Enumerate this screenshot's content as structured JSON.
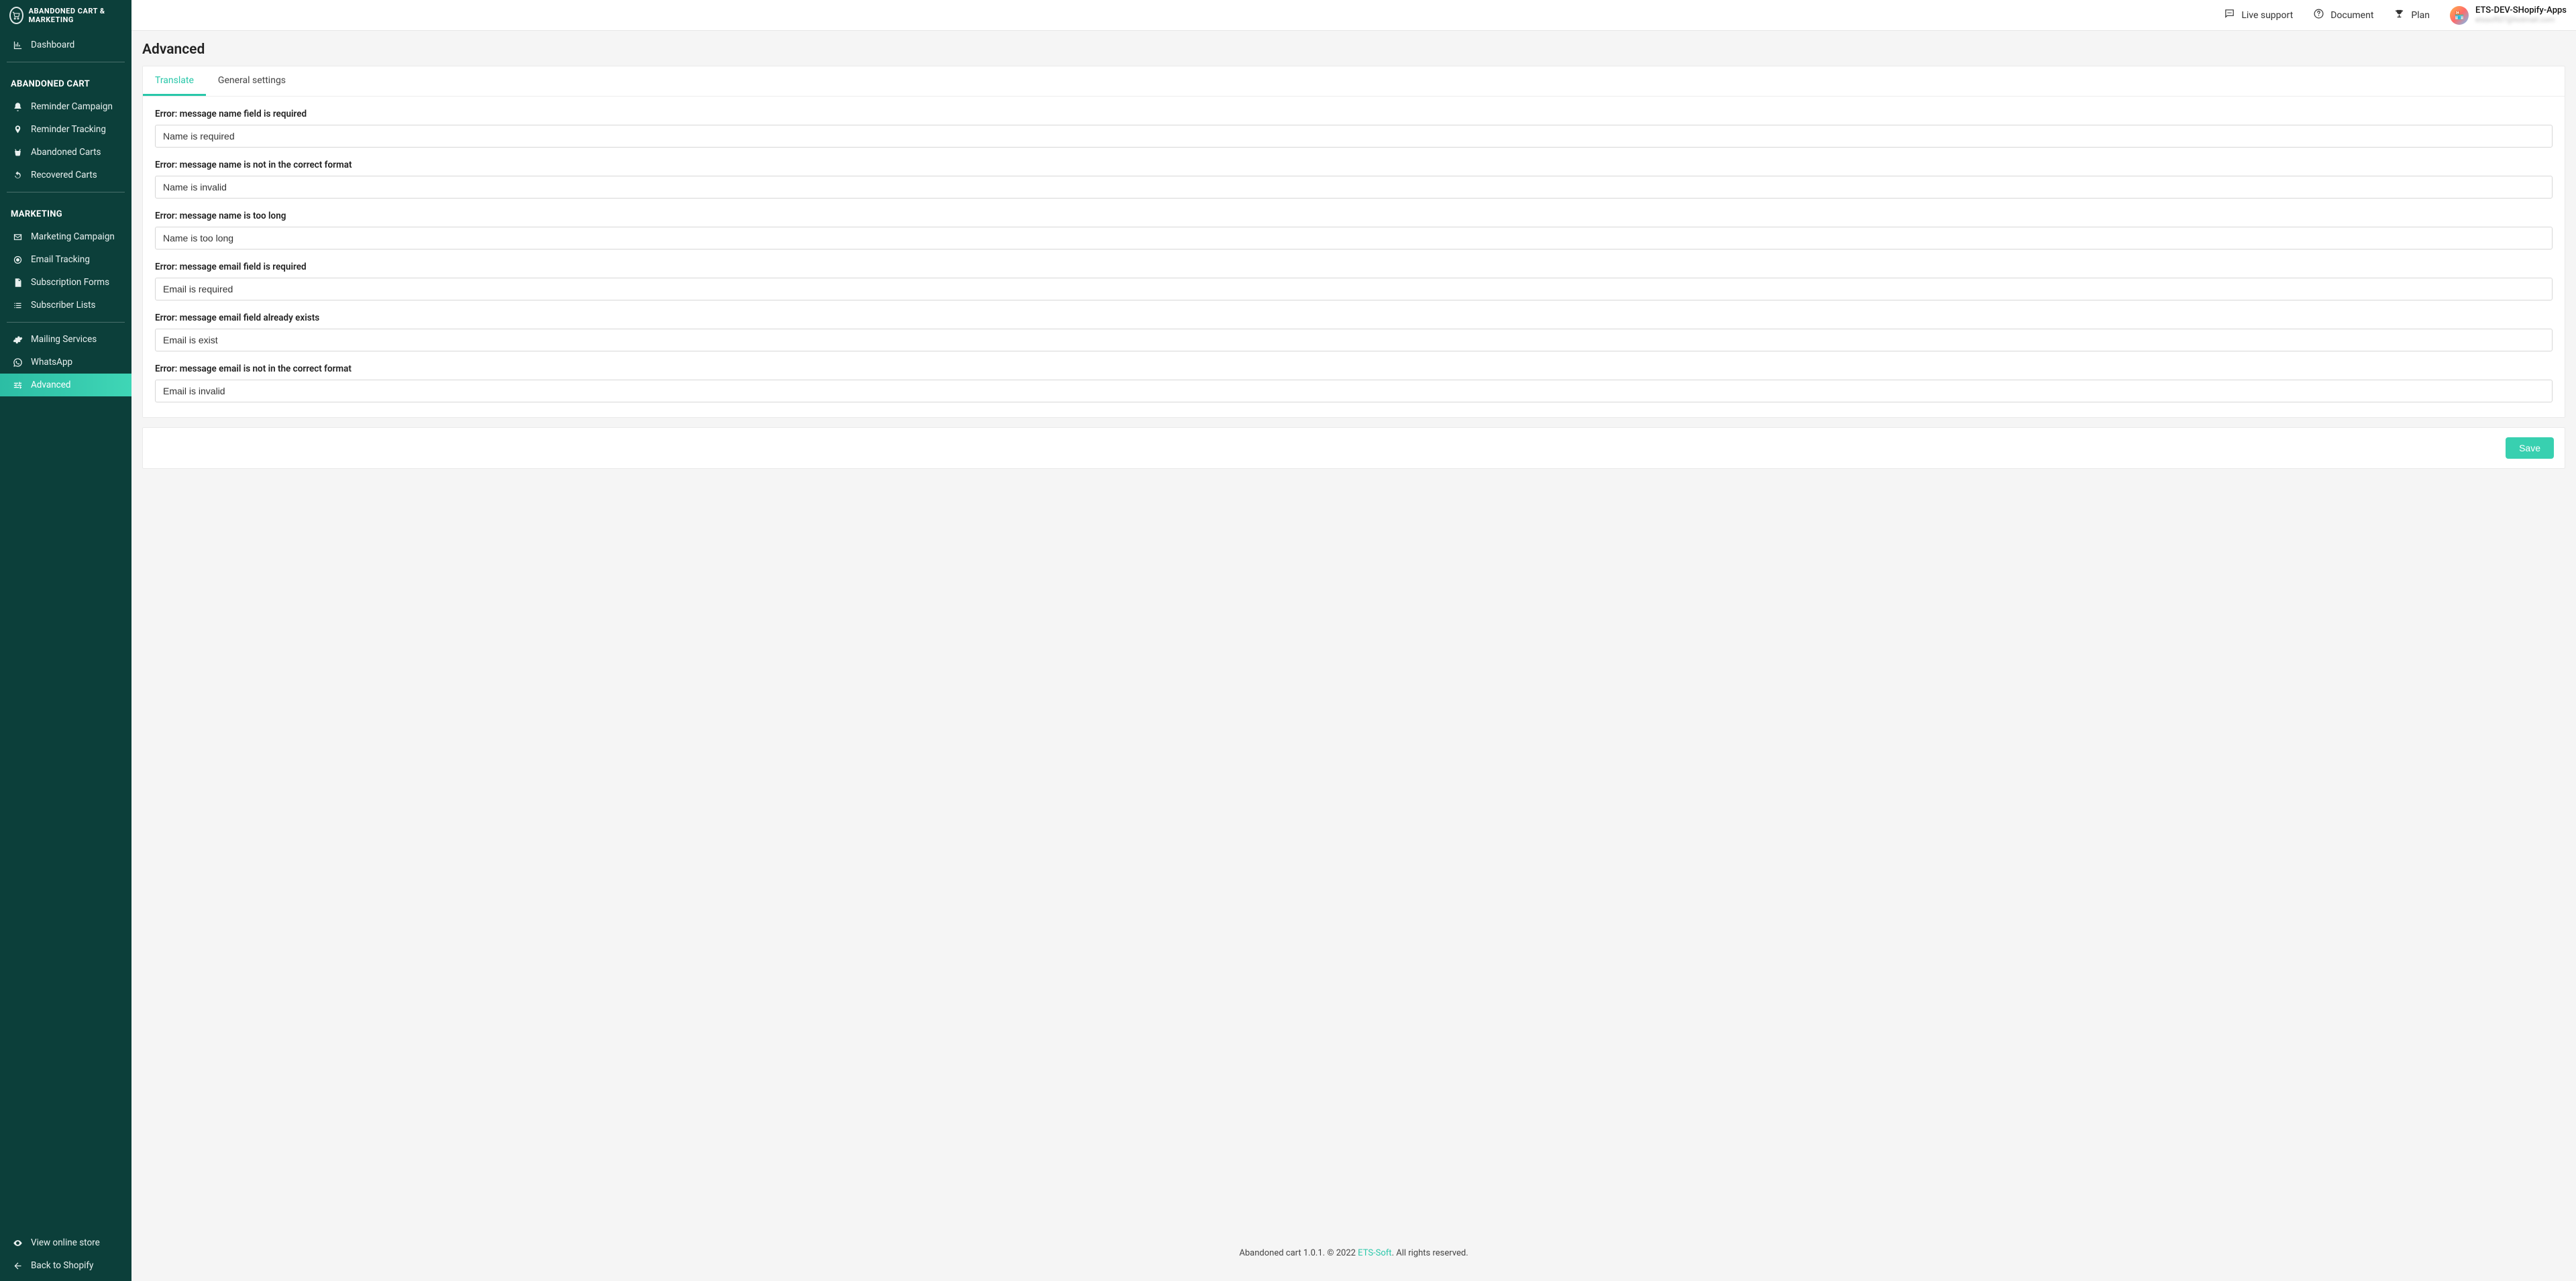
{
  "brand": "ABANDONED CART & MARKETING",
  "sidebar": {
    "dashboard": "Dashboard",
    "sections": [
      {
        "heading": "ABANDONED CART",
        "items": [
          {
            "label": "Reminder Campaign",
            "icon": "bell"
          },
          {
            "label": "Reminder Tracking",
            "icon": "pin"
          },
          {
            "label": "Abandoned Carts",
            "icon": "basket"
          },
          {
            "label": "Recovered Carts",
            "icon": "refresh"
          }
        ]
      },
      {
        "heading": "MARKETING",
        "items": [
          {
            "label": "Marketing Campaign",
            "icon": "mail"
          },
          {
            "label": "Email Tracking",
            "icon": "target"
          },
          {
            "label": "Subscription Forms",
            "icon": "file"
          },
          {
            "label": "Subscriber Lists",
            "icon": "list"
          }
        ]
      },
      {
        "heading": "",
        "items": [
          {
            "label": "Mailing Services",
            "icon": "gear"
          },
          {
            "label": "WhatsApp",
            "icon": "whatsapp"
          },
          {
            "label": "Advanced",
            "icon": "sliders",
            "active": true
          }
        ]
      }
    ],
    "footer": [
      {
        "label": "View online store",
        "icon": "eye"
      },
      {
        "label": "Back to Shopify",
        "icon": "back"
      }
    ]
  },
  "topbar": {
    "live_support": "Live support",
    "document": "Document",
    "plan": "Plan",
    "user": {
      "name": "ETS-DEV-SHopify-Apps",
      "email": "etssoft07@hotmail.com"
    }
  },
  "page": {
    "title": "Advanced",
    "tabs": {
      "translate": "Translate",
      "general": "General settings"
    },
    "fields": [
      {
        "label": "Error: message name field is required",
        "value": "Name is required"
      },
      {
        "label": "Error: message name is not in the correct format",
        "value": "Name is invalid"
      },
      {
        "label": "Error: message name is too long",
        "value": "Name is too long"
      },
      {
        "label": "Error: message email field is required",
        "value": "Email is required"
      },
      {
        "label": "Error: message email field already exists",
        "value": "Email is exist"
      },
      {
        "label": "Error: message email is not in the correct format",
        "value": "Email is invalid"
      }
    ],
    "save": "Save"
  },
  "footer": {
    "prefix": "Abandoned cart 1.0.1. © 2022 ",
    "link": "ETS-Soft",
    "suffix": ". All rights reserved."
  }
}
